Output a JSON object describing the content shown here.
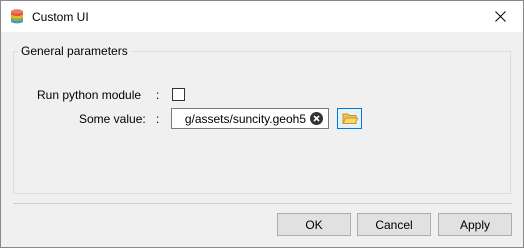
{
  "window": {
    "title": "Custom UI"
  },
  "group": {
    "title": "General parameters"
  },
  "fields": {
    "run_python": {
      "label": "Run python module",
      "separator": ":",
      "checked": false
    },
    "some_value": {
      "label": "Some value:",
      "separator": ":",
      "value": "g/assets/suncity.geoh5"
    }
  },
  "buttons": {
    "ok": "OK",
    "cancel": "Cancel",
    "apply": "Apply"
  },
  "icons": {
    "app": "stacked-layers-icon",
    "close": "close-icon",
    "clear": "clear-circle-icon",
    "browse": "folder-icon"
  },
  "colors": {
    "accent": "#0078d7",
    "folder": "#f5c244"
  }
}
